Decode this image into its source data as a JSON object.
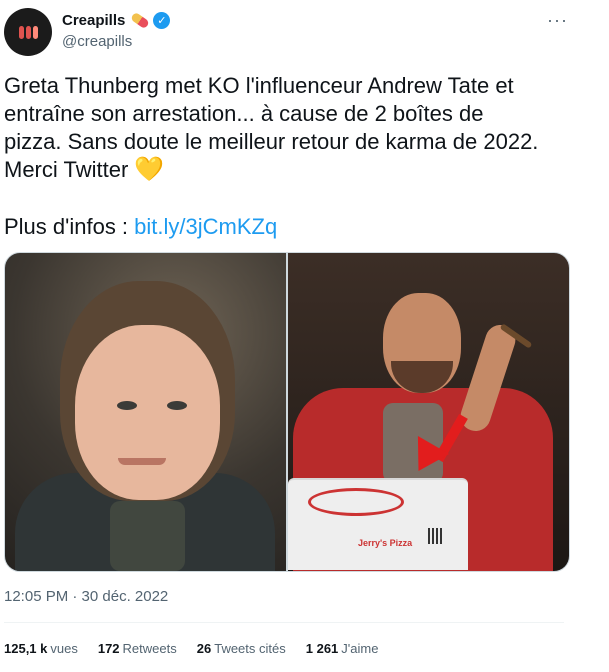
{
  "author": {
    "name": "Creapills",
    "handle": "@creapills",
    "verified_mark": "✓"
  },
  "menu": {
    "more_label": "···"
  },
  "tweet": {
    "text": "Greta Thunberg met KO l'influenceur Andrew Tate et\nentraîne son arrestation... à cause de 2 boîtes de\npizza. Sans doute le meilleur retour de karma de 2022.\nMerci Twitter ",
    "heart_emoji": "💛",
    "more_info_label": "Plus d'infos : ",
    "link_text": "bit.ly/3jCmKZq"
  },
  "media": {
    "pizza_box_text": "Jerry's Pizza"
  },
  "timestamp": "12:05 PM · 30 déc. 2022",
  "stats": [
    {
      "value": "125,1 k",
      "label": "vues"
    },
    {
      "value": "172",
      "label": "Retweets"
    },
    {
      "value": "26",
      "label": "Tweets cités"
    },
    {
      "value": "1 261",
      "label": "J'aime"
    }
  ],
  "colors": {
    "link": "#1d9bf0",
    "verified": "#1d9bf0",
    "secondary_text": "#536471",
    "heart": "#ffcf4a"
  },
  "icons": {
    "avatar": "creapills-pill-logo",
    "verified": "verified-badge-icon",
    "more": "more-horizontal-icon",
    "pill_emoji": "pill-icon"
  }
}
